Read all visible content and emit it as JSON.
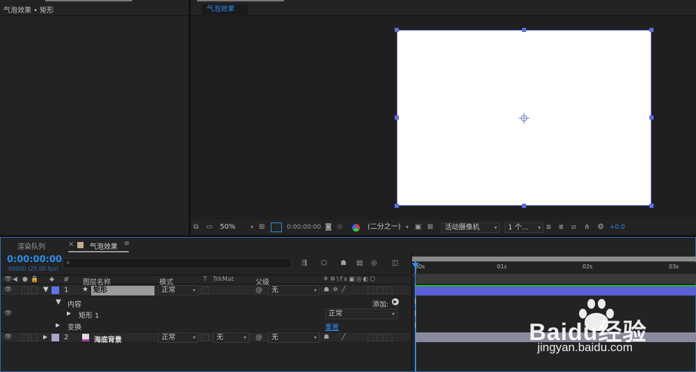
{
  "project_panel": {
    "title": "气泡效果 • 矩形"
  },
  "composition": {
    "tab": "气泡效果",
    "toolbar": {
      "zoom": "50%",
      "timecode": "0:00:00:00",
      "resolution": "(二分之一)",
      "camera": "活动摄像机",
      "views": "1 个...",
      "exposure": "+0.0"
    }
  },
  "timeline": {
    "tabs": [
      {
        "label": "渲染队列"
      },
      {
        "label": "气泡效果"
      }
    ],
    "timecode": "0:00:00:00",
    "fps": "00000 (25.00 fps)",
    "search_placeholder": "",
    "columns": {
      "num": "#",
      "layer_name": "图层名称",
      "mode": "模式",
      "t": "T",
      "trkmat": "TrkMat",
      "parent": "父级"
    },
    "ruler": [
      "00s",
      "01s",
      "02s",
      "03s"
    ],
    "layers": [
      {
        "num": "1",
        "name": "矩形",
        "mode": "正常",
        "parent": "无",
        "color": "#5a76e6"
      },
      {
        "num": "2",
        "name": "海底背景",
        "mode": "正常",
        "trkmat": "无",
        "parent": "无",
        "color": "#a8a8cc"
      }
    ],
    "sub": {
      "contents": "内容",
      "add": "添加:",
      "rect": "矩形 1",
      "rect_mode": "正常",
      "transform": "变换",
      "reset": "重置"
    }
  },
  "watermark": {
    "brand": "Baidu经验",
    "url": "jingyan.baidu.com"
  },
  "colors": {
    "accent": "#2d8ceb",
    "layer1_bar": "#5a5fd6",
    "layer2_bar": "#8a8a9e",
    "comp_bg": "#ffffff"
  }
}
